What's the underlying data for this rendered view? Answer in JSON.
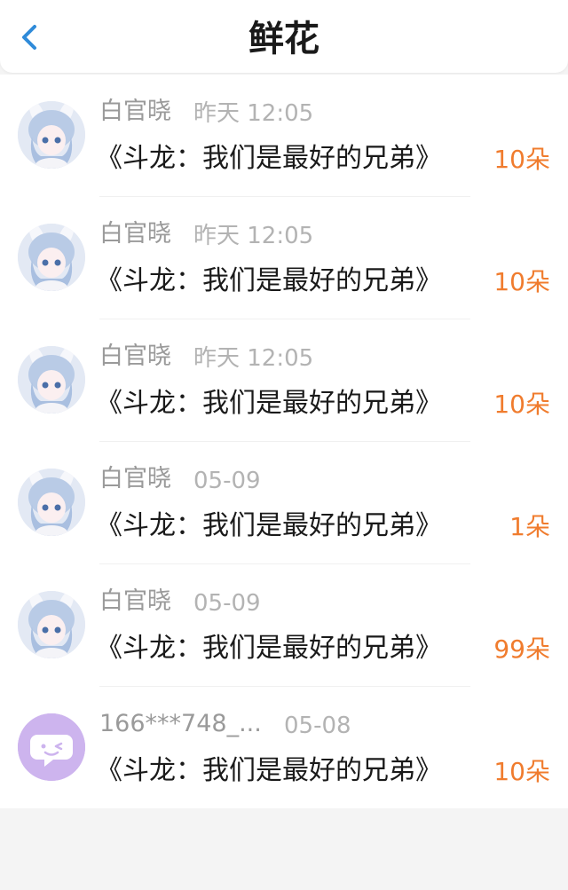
{
  "header": {
    "title": "鲜花",
    "back_icon": "chevron-left-icon"
  },
  "colors": {
    "accent_blue": "#2f8bd9",
    "flower_count_orange": "#f07c2e",
    "meta_gray": "#9a9a9a"
  },
  "rows": [
    {
      "name": "白官晓",
      "time": "昨天 12:05",
      "message": "《斗龙：我们是最好的兄弟》",
      "count": "10朵",
      "avatar": "anime-avatar"
    },
    {
      "name": "白官晓",
      "time": "昨天 12:05",
      "message": "《斗龙：我们是最好的兄弟》",
      "count": "10朵",
      "avatar": "anime-avatar"
    },
    {
      "name": "白官晓",
      "time": "昨天 12:05",
      "message": "《斗龙：我们是最好的兄弟》",
      "count": "10朵",
      "avatar": "anime-avatar"
    },
    {
      "name": "白官晓",
      "time": "05-09",
      "message": "《斗龙：我们是最好的兄弟》",
      "count": "1朵",
      "avatar": "anime-avatar"
    },
    {
      "name": "白官晓",
      "time": "05-09",
      "message": "《斗龙：我们是最好的兄弟》",
      "count": "99朵",
      "avatar": "anime-avatar"
    },
    {
      "name": "166***748_...",
      "time": "05-08",
      "message": "《斗龙：我们是最好的兄弟》",
      "count": "10朵",
      "avatar": "chat-bubble-avatar"
    }
  ]
}
